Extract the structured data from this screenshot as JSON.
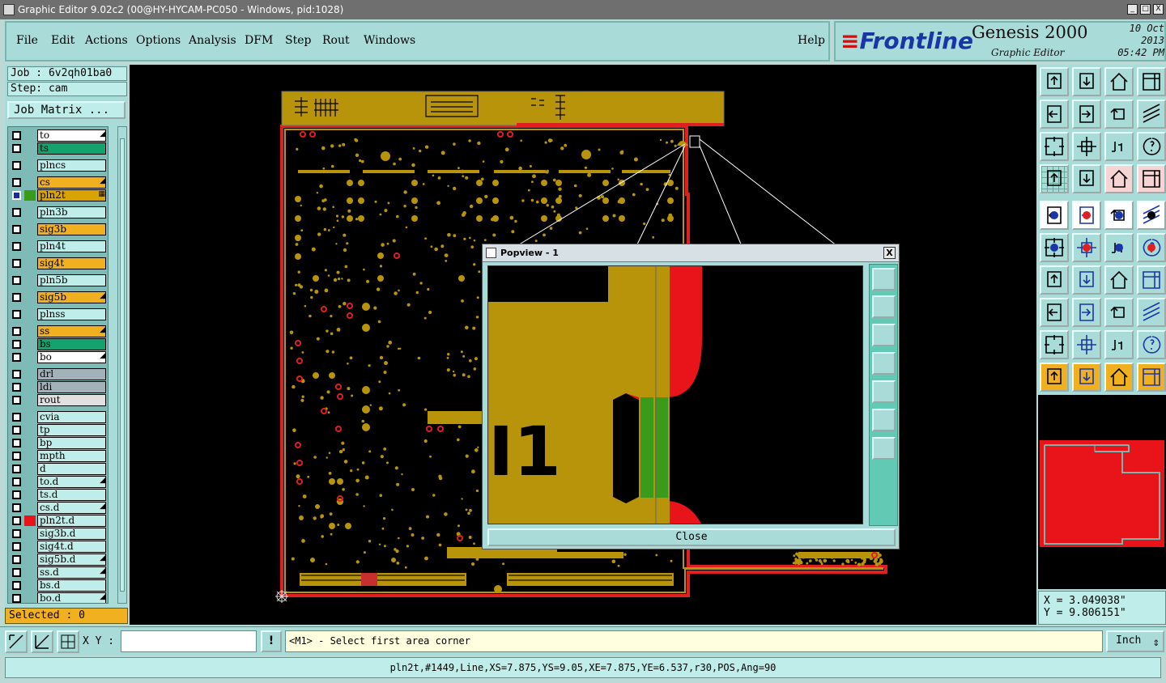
{
  "window": {
    "title": "Graphic Editor 9.02c2 (00@HY-HYCAM-PC050 - Windows, pid:1028)",
    "buttons": [
      "_",
      "□",
      "X"
    ]
  },
  "menu": {
    "items": [
      "File",
      "Edit",
      "Actions",
      "Options",
      "Analysis",
      "DFM",
      "Step",
      "Rout",
      "Windows"
    ],
    "help": "Help"
  },
  "banner": {
    "logo": "Frontline",
    "product": "Genesis 2000",
    "subtitle": "Graphic Editor",
    "date": "10 Oct 2013",
    "time": "05:42 PM"
  },
  "job": {
    "job_label": "Job : 6v2qh01ba0",
    "step_label": "Step: cam",
    "matrix_button": "Job Matrix ..."
  },
  "layers": [
    {
      "name": "to",
      "color": "#ffffff",
      "flag": "◢"
    },
    {
      "name": "ts",
      "color": "#14a36f",
      "flag": ""
    },
    {
      "name": "plncs",
      "color": "#bfeeea",
      "flag": ""
    },
    {
      "name": "cs",
      "color": "#f0b020",
      "flag": "◢"
    },
    {
      "name": "pln2t",
      "color": "#d9a400",
      "flag": "▦"
    },
    {
      "name": "pln3b",
      "color": "#bfeeea",
      "flag": ""
    },
    {
      "name": "sig3b",
      "color": "#f0b020",
      "flag": ""
    },
    {
      "name": "pln4t",
      "color": "#bfeeea",
      "flag": ""
    },
    {
      "name": "sig4t",
      "color": "#f0b020",
      "flag": ""
    },
    {
      "name": "pln5b",
      "color": "#bfeeea",
      "flag": ""
    },
    {
      "name": "sig5b",
      "color": "#f0b020",
      "flag": "◢"
    },
    {
      "name": "plnss",
      "color": "#bfeeea",
      "flag": ""
    },
    {
      "name": "ss",
      "color": "#f0b020",
      "flag": "◢"
    },
    {
      "name": "bs",
      "color": "#14a36f",
      "flag": ""
    },
    {
      "name": "bo",
      "color": "#ffffff",
      "flag": "◢"
    },
    {
      "name": "drl",
      "color": "#a2b2b8",
      "flag": ""
    },
    {
      "name": "ldi",
      "color": "#a2b2b8",
      "flag": ""
    },
    {
      "name": "rout",
      "color": "#e0e0e0",
      "flag": ""
    },
    {
      "name": "cvia",
      "color": "#bfeeea",
      "flag": ""
    },
    {
      "name": "tp",
      "color": "#bfeeea",
      "flag": ""
    },
    {
      "name": "bp",
      "color": "#bfeeea",
      "flag": ""
    },
    {
      "name": "mpth",
      "color": "#bfeeea",
      "flag": ""
    },
    {
      "name": "d",
      "color": "#bfeeea",
      "flag": ""
    },
    {
      "name": "to.d",
      "color": "#bfeeea",
      "flag": "◢"
    },
    {
      "name": "ts.d",
      "color": "#bfeeea",
      "flag": ""
    },
    {
      "name": "cs.d",
      "color": "#bfeeea",
      "flag": "◢"
    },
    {
      "name": "pln2t.d",
      "color": "#bfeeea",
      "flag": ""
    },
    {
      "name": "sig3b.d",
      "color": "#bfeeea",
      "flag": ""
    },
    {
      "name": "sig4t.d",
      "color": "#bfeeea",
      "flag": ""
    },
    {
      "name": "sig5b.d",
      "color": "#bfeeea",
      "flag": "◢"
    },
    {
      "name": "ss.d",
      "color": "#bfeeea",
      "flag": "◢"
    },
    {
      "name": "bs.d",
      "color": "#bfeeea",
      "flag": ""
    },
    {
      "name": "bo.d",
      "color": "#bfeeea",
      "flag": "◢"
    }
  ],
  "selected": "Selected : 0",
  "popview": {
    "title": "Popview - 1",
    "close_x": "X",
    "close_button": "Close",
    "zoom_text": "I1"
  },
  "coords": {
    "x": "X = 3.049038\"",
    "y": "Y = 9.806151\""
  },
  "bottom": {
    "xy_label": "X Y :",
    "xy_value": "",
    "bang": "!",
    "prompt": "<M1> - Select first area corner",
    "units": "Inch",
    "units_arrow": "⇕"
  },
  "status": "pln2t,#1449,Line,XS=7.875,YS=9.05,XE=7.875,YE=6.537,r30,POS,Ang=90",
  "colors": {
    "pad": "#b8940a",
    "outline": "#e02020",
    "accent": "#a9dcd8"
  }
}
